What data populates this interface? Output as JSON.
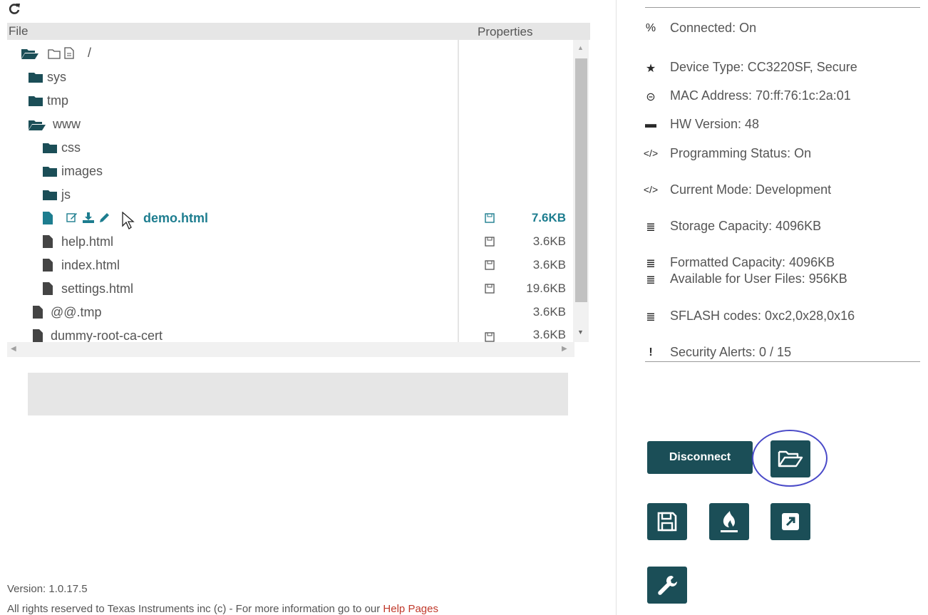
{
  "header": {
    "file_col": "File",
    "properties_col": "Properties"
  },
  "tree": {
    "root_label": "/",
    "rows": [
      {
        "label": "sys",
        "type": "folder",
        "size": ""
      },
      {
        "label": "tmp",
        "type": "folder",
        "size": ""
      },
      {
        "label": "www",
        "type": "folder-open",
        "size": ""
      },
      {
        "label": "css",
        "type": "folder",
        "size": ""
      },
      {
        "label": "images",
        "type": "folder",
        "size": ""
      },
      {
        "label": "js",
        "type": "folder",
        "size": ""
      },
      {
        "label": "demo.html",
        "type": "file",
        "size": "7.6KB",
        "selected": true
      },
      {
        "label": "help.html",
        "type": "file",
        "size": "3.6KB"
      },
      {
        "label": "index.html",
        "type": "file",
        "size": "3.6KB"
      },
      {
        "label": "settings.html",
        "type": "file",
        "size": "19.6KB"
      },
      {
        "label": "@@.tmp",
        "type": "file",
        "size": "3.6KB"
      },
      {
        "label": "dummy-root-ca-cert",
        "type": "file",
        "size": "3.6KB"
      }
    ]
  },
  "device_info": {
    "connected": "Connected: On",
    "device_type": "Device Type: CC3220SF, Secure",
    "mac_address": "MAC Address: 70:ff:76:1c:2a:01",
    "hw_version": "HW Version: 48",
    "programming_status": "Programming Status: On",
    "current_mode": "Current Mode: Development",
    "storage_capacity": "Storage Capacity: 4096KB",
    "formatted_capacity": "Formatted Capacity: 4096KB",
    "available_user_files": "Available for User Files: 956KB",
    "sflash_codes": "SFLASH codes: 0xc2,0x28,0x16",
    "security_alerts": "Security Alerts: 0 / 15"
  },
  "actions": {
    "disconnect_label": "Disconnect"
  },
  "footer": {
    "version": "Version: 1.0.17.5",
    "rights": "All rights reserved to Texas Instruments inc (c) - For more information go to our",
    "help_link": "Help Pages"
  },
  "colors": {
    "accent": "#1b4e57",
    "selected_text": "#1d7d8f",
    "link": "#c0392b",
    "highlight_ring": "#4a4ac8"
  }
}
